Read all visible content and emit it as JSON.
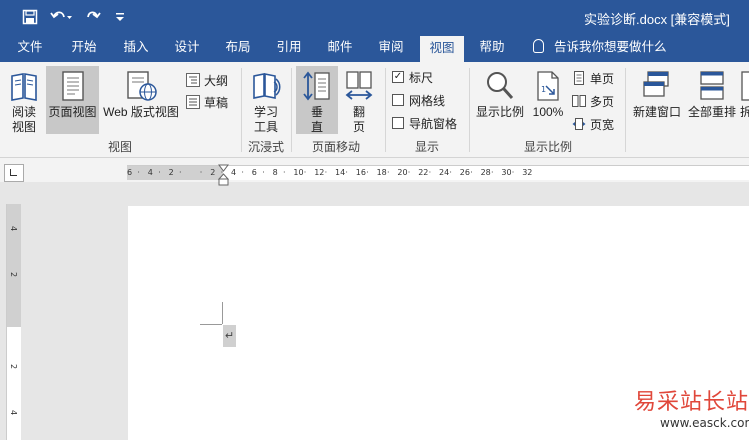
{
  "title_bar": {
    "document_title": "实验诊断.docx [兼容模式]",
    "qat": [
      "save-icon",
      "undo-icon",
      "redo-icon",
      "customize-icon"
    ]
  },
  "tabs": [
    {
      "label": "文件"
    },
    {
      "label": "开始"
    },
    {
      "label": "插入"
    },
    {
      "label": "设计"
    },
    {
      "label": "布局"
    },
    {
      "label": "引用"
    },
    {
      "label": "邮件"
    },
    {
      "label": "审阅"
    },
    {
      "label": "视图",
      "active": true
    },
    {
      "label": "帮助"
    }
  ],
  "tell_me": "告诉我你想要做什么",
  "ribbon": {
    "views": {
      "label": "视图",
      "read_mode": "阅读\n视图",
      "print_layout": "页面视图",
      "web_layout": "Web 版式视图",
      "outline": "大纲",
      "draft": "草稿"
    },
    "immersive": {
      "label": "沉浸式",
      "learning_tools": "学习\n工具"
    },
    "page_movement": {
      "label": "页面移动",
      "vertical": "垂\n直",
      "side_to_side": "翻\n页"
    },
    "show": {
      "label": "显示",
      "ruler": "标尺",
      "ruler_checked": true,
      "gridlines": "网格线",
      "gridlines_checked": false,
      "nav_pane": "导航窗格",
      "nav_pane_checked": false
    },
    "zoom": {
      "label": "显示比例",
      "zoom": "显示比例",
      "hundred": "100%",
      "one_page": "单页",
      "multiple_pages": "多页",
      "page_width": "页宽"
    },
    "window": {
      "new_window": "新建窗口",
      "arrange_all": "全部重排",
      "split_partial": "拆"
    }
  },
  "ruler": {
    "h_ticks": [
      "6",
      "4",
      "2",
      "",
      "2",
      "4",
      "6",
      "8",
      "10",
      "12",
      "14",
      "16",
      "18",
      "20",
      "22",
      "24",
      "26",
      "28",
      "30",
      "32"
    ],
    "v_ticks": [
      "4",
      "2",
      "",
      "2",
      "4"
    ]
  },
  "document": {
    "paragraph_mark": "↵"
  },
  "watermark": {
    "text": "易采站长站",
    "url": "www.easck.com"
  },
  "colors": {
    "title_bar": "#2b579a",
    "ribbon_bg": "#f3f3f3",
    "active_button": "#c8c8c8",
    "watermark": "#e0473a"
  }
}
